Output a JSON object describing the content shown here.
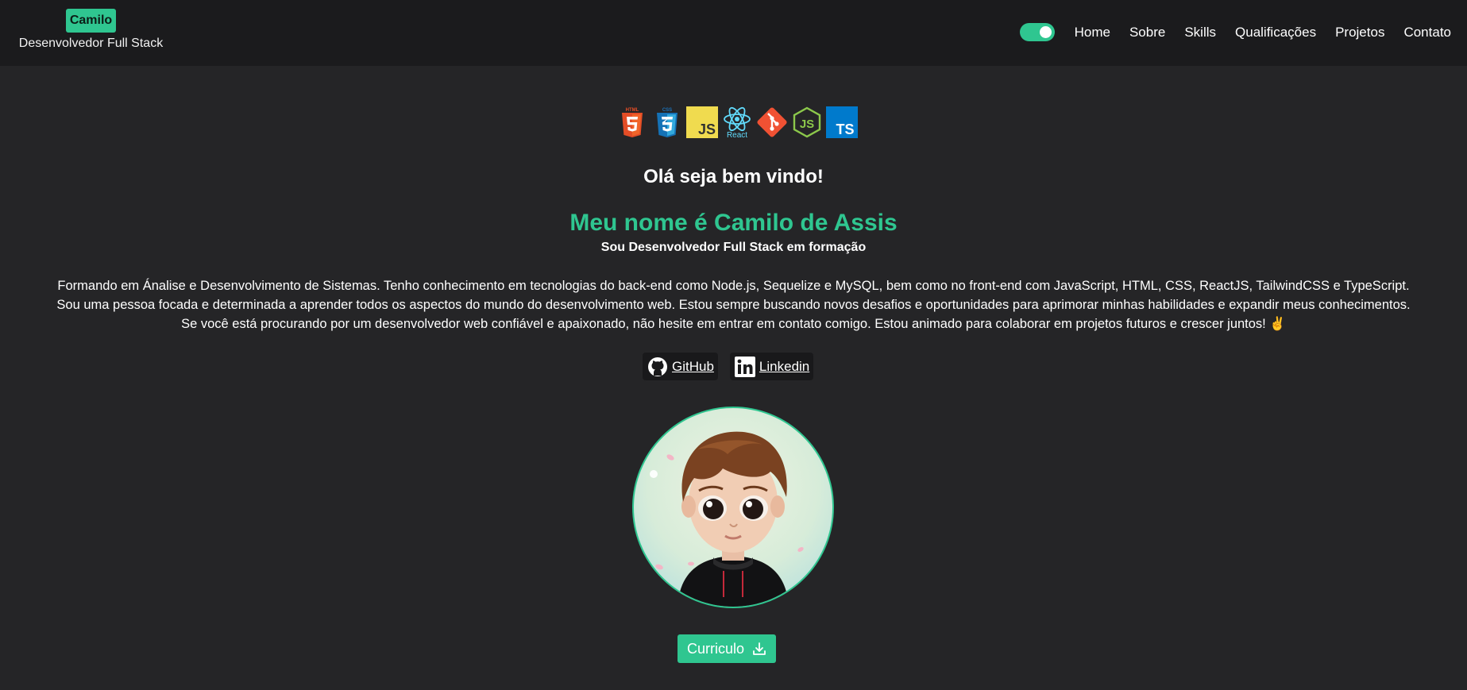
{
  "brand": {
    "name": "Camilo",
    "subtitle": "Desenvolvedor Full Stack"
  },
  "nav": {
    "theme_toggle_on": true,
    "items": [
      "Home",
      "Sobre",
      "Skills",
      "Qualificações",
      "Projetos",
      "Contato"
    ]
  },
  "tech_icons": [
    {
      "icon": "html5-icon",
      "label": "HTML"
    },
    {
      "icon": "css3-icon",
      "label": "CSS"
    },
    {
      "icon": "javascript-icon",
      "label": "JS"
    },
    {
      "icon": "react-icon",
      "label": "React"
    },
    {
      "icon": "git-icon"
    },
    {
      "icon": "nodejs-icon",
      "label": "JS"
    },
    {
      "icon": "typescript-icon",
      "label": "TS"
    }
  ],
  "hero": {
    "greeting": "Olá seja bem vindo!",
    "name": "Meu nome é Camilo de Assis",
    "role": "Sou Desenvolvedor Full Stack em formação",
    "bio": [
      "Formando em Ánalise e Desenvolvimento de Sistemas. Tenho conhecimento em tecnologias do back-end como Node.js, Sequelize e MySQL, bem como no front-end com JavaScript, HTML, CSS, ReactJS, TailwindCSS e TypeScript.",
      "Sou uma pessoa focada e determinada a aprender todos os aspectos do mundo do desenvolvimento web. Estou sempre buscando novos desafios e oportunidades para aprimorar minhas habilidades e expandir meus conhecimentos.",
      "Se você está procurando por um desenvolvedor web confiável e apaixonado, não hesite em entrar em contato comigo. Estou animado para colaborar em projetos futuros e crescer juntos! ✌️"
    ]
  },
  "socials": [
    {
      "label": "GitHub",
      "icon": "github-icon"
    },
    {
      "label": "Linkedin",
      "icon": "linkedin-icon"
    }
  ],
  "cv_button": {
    "label": "Curriculo",
    "icon": "download-icon"
  },
  "colors": {
    "accent": "#2fc690",
    "background": "#252527",
    "header": "#1b1b1d"
  }
}
